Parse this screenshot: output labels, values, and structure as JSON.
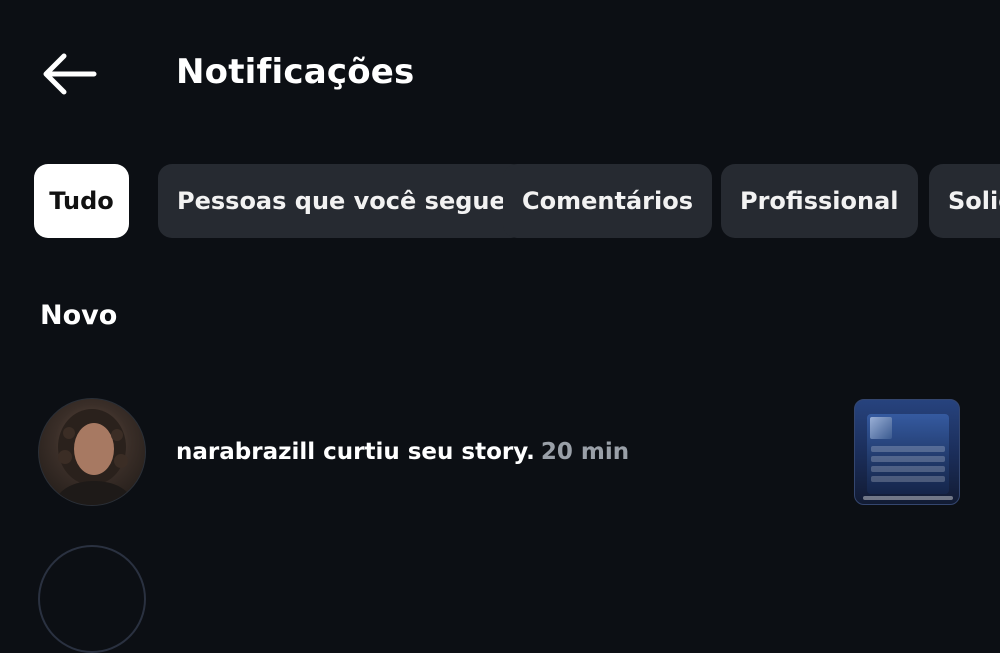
{
  "header": {
    "back_icon": "arrow-left-icon",
    "title": "Notificações"
  },
  "filters": {
    "chips": [
      {
        "label": "Tudo",
        "active": true
      },
      {
        "label": "Pessoas que você segue",
        "active": false
      },
      {
        "label": "Comentários",
        "active": false
      },
      {
        "label": "Profissional",
        "active": false
      },
      {
        "label": "Solic",
        "active": false
      }
    ]
  },
  "section": {
    "title": "Novo"
  },
  "notifications": [
    {
      "username": "narabrazill",
      "action": " curtiu seu story.",
      "time": "20 min",
      "thumbnail_icon": "story-thumbnail"
    }
  ],
  "colors": {
    "background": "#0c0f14",
    "chip_bg": "#262a31",
    "chip_active_bg": "#ffffff",
    "muted_text": "#9aa0a8"
  }
}
